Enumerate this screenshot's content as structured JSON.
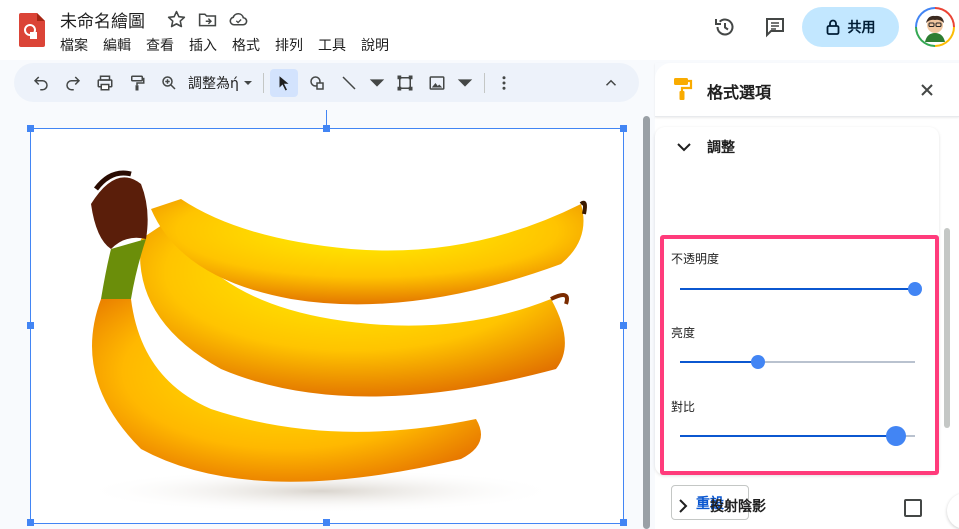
{
  "document": {
    "title": "未命名繪圖"
  },
  "menu": {
    "items": [
      "檔案",
      "編輯",
      "查看",
      "插入",
      "格式",
      "排列",
      "工具",
      "說明"
    ]
  },
  "header": {
    "share_label": "共用"
  },
  "toolbar": {
    "adjust_label": "調整為ή"
  },
  "panel": {
    "title": "格式選項",
    "adjust_section": "調整",
    "sliders": [
      {
        "label": "不透明度",
        "value": 1.0
      },
      {
        "label": "亮度",
        "value": 0.33
      },
      {
        "label": "對比",
        "value": 0.92
      }
    ],
    "reset_label": "重設",
    "shadow_section": "投射陰影",
    "shadow_checked": false
  },
  "colors": {
    "accent": "#0b57d0",
    "share_bg": "#c2e7ff",
    "highlight": "#ff3b7b",
    "selection": "#4285f4"
  }
}
